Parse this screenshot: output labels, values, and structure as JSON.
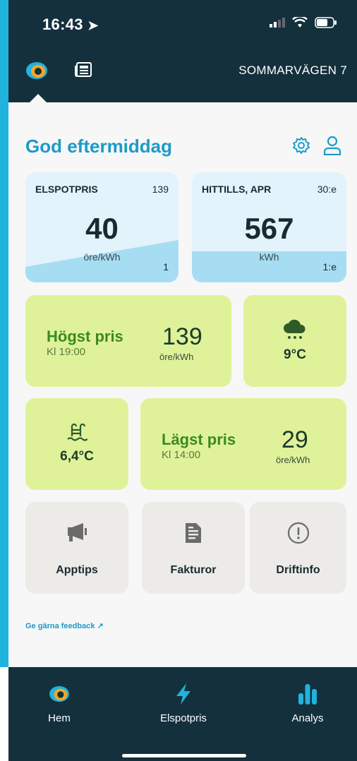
{
  "status_bar": {
    "time": "16:43"
  },
  "header": {
    "address": "SOMMARVÄGEN 7"
  },
  "greeting": "God eftermiddag",
  "elspotpris_card": {
    "label": "ELSPOTPRIS",
    "count": "139",
    "value": "40",
    "unit": "öre/kWh",
    "corner": "1"
  },
  "hittills_card": {
    "label": "HITTILLS, APR",
    "count": "30:e",
    "value": "567",
    "unit": "kWh",
    "corner": "1:e"
  },
  "high_price": {
    "title": "Högst pris",
    "time": "Kl 19:00",
    "value": "139",
    "unit": "öre/kWh"
  },
  "weather": {
    "temperature": "9°C",
    "icon": "rain-cloud-icon"
  },
  "pool": {
    "temperature": "6,4°C",
    "icon": "pool-icon"
  },
  "low_price": {
    "title": "Lägst pris",
    "time": "Kl 14:00",
    "value": "29",
    "unit": "öre/kWh"
  },
  "tiles": {
    "apptips": "Apptips",
    "fakturor": "Fakturor",
    "driftinfo": "Driftinfo"
  },
  "feedback_link": "Ge gärna feedback",
  "tabs": {
    "home": "Hem",
    "spot": "Elspotpris",
    "analys": "Analys"
  },
  "colors": {
    "header_bg": "#14303d",
    "accent": "#1b9bc9",
    "green_card": "#dff29a",
    "grey_card": "#ecebe7",
    "blue_card": "#e3f3fb"
  }
}
